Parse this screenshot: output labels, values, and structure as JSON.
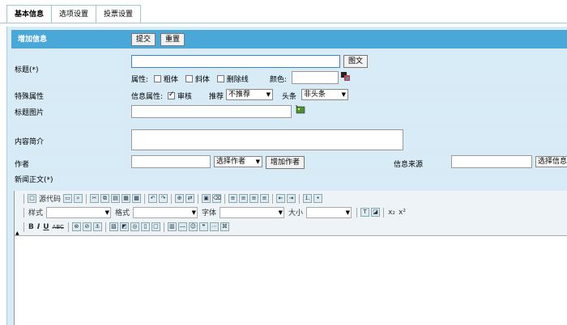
{
  "tabs": [
    "基本信息",
    "选项设置",
    "投票设置"
  ],
  "header": {
    "title": "增加信息",
    "submit": "提交",
    "reset": "重置"
  },
  "title_row": {
    "label": "标题(*)",
    "pic_button": "图文",
    "attr_label": "属性:",
    "bold": "粗体",
    "italic": "斜体",
    "strike": "删除线",
    "color_label": "颜色:"
  },
  "special_row": {
    "label": "特殊属性",
    "info_attr": "信息属性:",
    "review": "审核",
    "recommend_label": "推荐",
    "recommend_value": "不推荐",
    "headline_label": "头条",
    "headline_value": "非头条"
  },
  "title_pic_row": {
    "label": "标题图片"
  },
  "intro_row": {
    "label": "内容简介"
  },
  "author_row": {
    "label": "作者",
    "select_author": "选择作者",
    "add_author": "增加作者",
    "source_label": "信息来源",
    "select_source": "选择信息"
  },
  "body_row": {
    "label": "新闻正文(*)"
  },
  "editor": {
    "source": "源代码",
    "style": "样式",
    "format": "格式",
    "font": "字体",
    "size": "大小",
    "bold": "B",
    "italic": "I",
    "underline": "U",
    "strike": "ABC",
    "sub": "x₂",
    "sup": "x²"
  }
}
